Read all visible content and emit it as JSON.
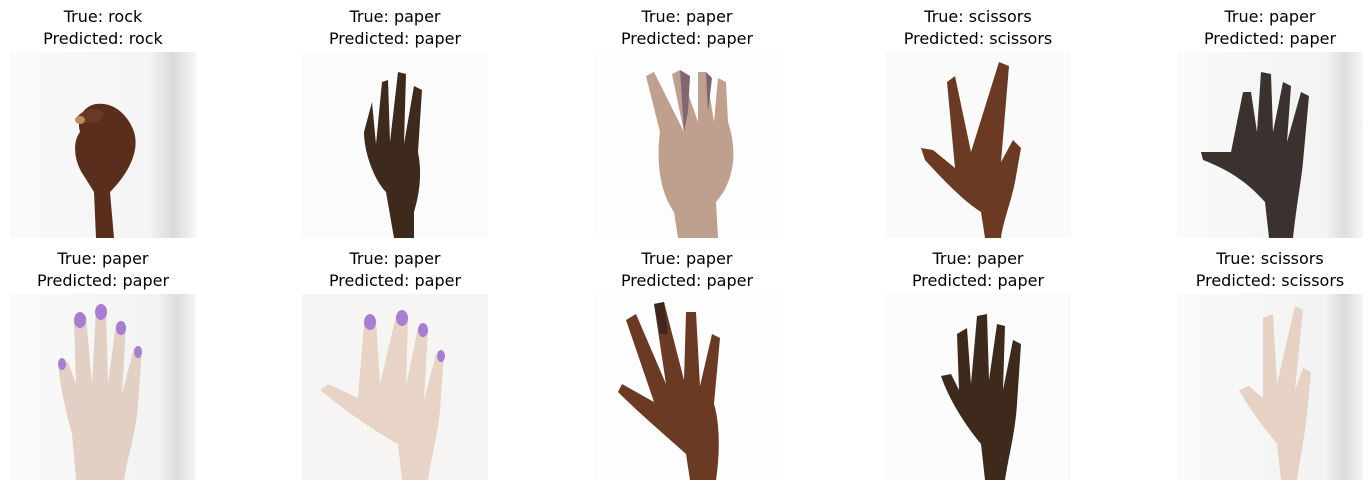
{
  "panels": [
    {
      "true_label": "True: rock",
      "predicted_label": "Predicted: rock",
      "image": "hand-rock-dark-skin"
    },
    {
      "true_label": "True: paper",
      "predicted_label": "Predicted: paper",
      "image": "hand-paper-very-dark-skin"
    },
    {
      "true_label": "True: paper",
      "predicted_label": "Predicted: paper",
      "image": "hand-paper-light-skin-tilted"
    },
    {
      "true_label": "True: scissors",
      "predicted_label": "Predicted: scissors",
      "image": "hand-scissors-dark-skin"
    },
    {
      "true_label": "True: paper",
      "predicted_label": "Predicted: paper",
      "image": "hand-paper-very-dark-skin-thumb-out"
    },
    {
      "true_label": "True: paper",
      "predicted_label": "Predicted: paper",
      "image": "hand-paper-light-skin-purple-nails"
    },
    {
      "true_label": "True: paper",
      "predicted_label": "Predicted: paper",
      "image": "hand-paper-light-skin-purple-nails-thumb-out"
    },
    {
      "true_label": "True: paper",
      "predicted_label": "Predicted: paper",
      "image": "hand-paper-dark-skin-tilted"
    },
    {
      "true_label": "True: paper",
      "predicted_label": "Predicted: paper",
      "image": "hand-paper-very-dark-skin"
    },
    {
      "true_label": "True: scissors",
      "predicted_label": "Predicted: scissors",
      "image": "hand-scissors-light-skin"
    }
  ]
}
